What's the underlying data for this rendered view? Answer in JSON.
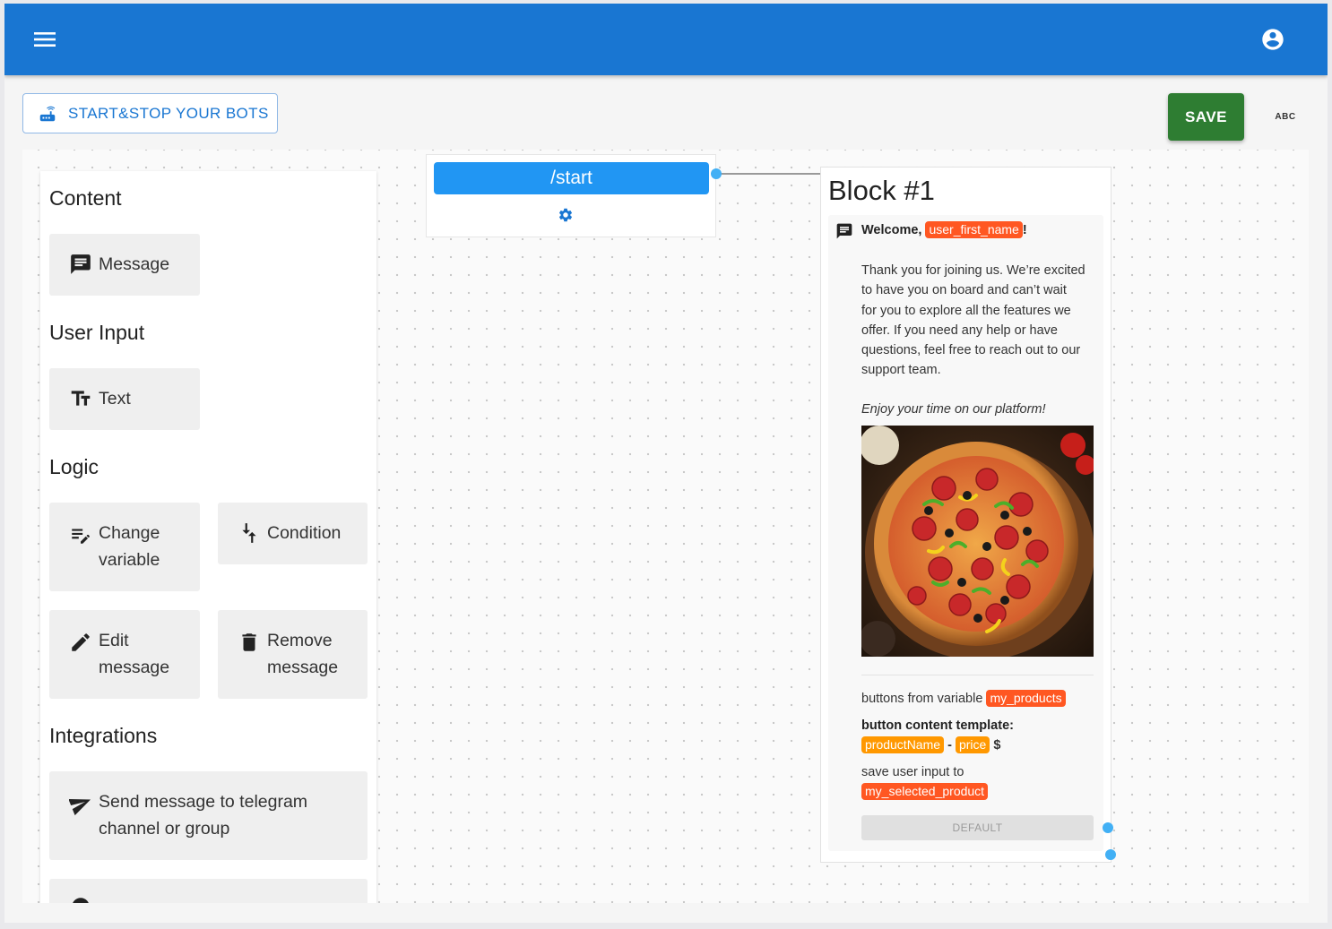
{
  "toolbar": {
    "start_stop_label": "START&STOP YOUR BOTS",
    "save_label": "SAVE",
    "abc_label": "ABC"
  },
  "palette": {
    "sections": [
      {
        "title": "Content",
        "items": [
          {
            "label": "Message",
            "icon": "message-icon"
          }
        ]
      },
      {
        "title": "User Input",
        "items": [
          {
            "label": "Text",
            "icon": "text-fields-icon"
          }
        ]
      },
      {
        "title": "Logic",
        "items": [
          {
            "label": "Change variable",
            "icon": "edit-note-icon"
          },
          {
            "label": "Condition",
            "icon": "fork-icon"
          },
          {
            "label": "Edit message",
            "icon": "pencil-icon"
          },
          {
            "label": "Remove message",
            "icon": "trash-icon"
          }
        ]
      },
      {
        "title": "Integrations",
        "items": [
          {
            "label": "Send message to telegram channel or group",
            "icon": "send-icon"
          }
        ]
      }
    ]
  },
  "start_node": {
    "command": "/start",
    "settings_icon": "gear-icon"
  },
  "block": {
    "title": "Block #1",
    "message": {
      "greeting": "Welcome,",
      "greeting_variable": "user_first_name",
      "greeting_suffix": "!",
      "body_lines": [
        "Thank you for joining us. We’re excited",
        "to have you on board and can’t wait",
        "for you to explore all the features we",
        "offer. If you need any help or have",
        "questions, feel free to reach out to our",
        "support team."
      ],
      "closing": "Enjoy your time on our platform!",
      "image": "pizza-photo"
    },
    "buttons_from_variable_label": "buttons from variable",
    "buttons_variable": "my_products",
    "button_template_label": "button content template:",
    "template_field_1": "productName",
    "template_separator": "-",
    "template_field_2": "price",
    "template_suffix": "$",
    "save_input_label": "save user input to",
    "save_input_variable": "my_selected_product",
    "default_button": "DEFAULT"
  },
  "colors": {
    "appbar": "#1976d2",
    "save": "#2e7d32",
    "start_button": "#2196f3",
    "variable_tag": "#ff5722",
    "template_tag": "#ff9800",
    "port": "#42b0f5"
  }
}
